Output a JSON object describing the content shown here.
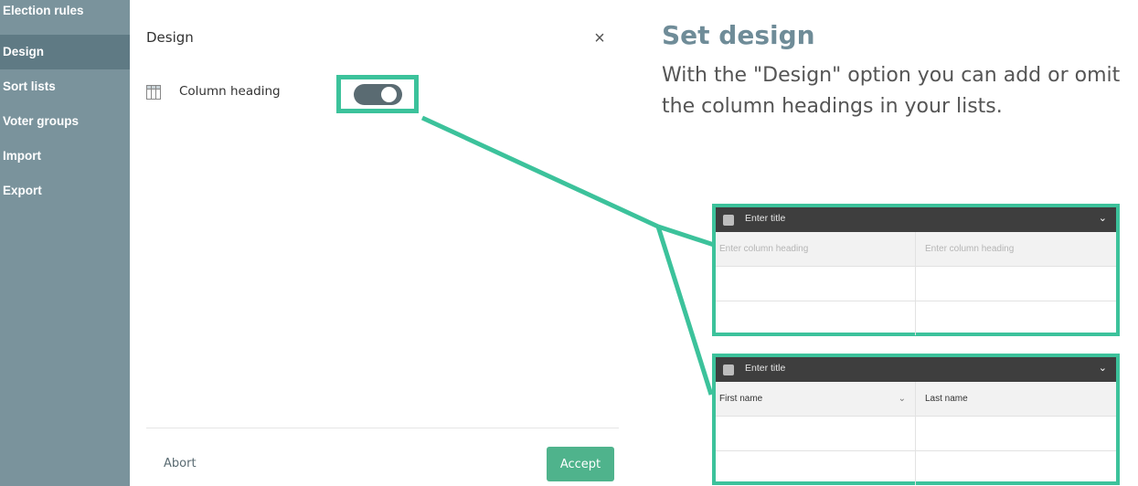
{
  "sidebar": {
    "items": [
      {
        "label": "Election rules"
      },
      {
        "label": "Design"
      },
      {
        "label": "Sort lists"
      },
      {
        "label": "Voter groups"
      },
      {
        "label": "Import"
      },
      {
        "label": "Export"
      }
    ]
  },
  "dialog": {
    "title": "Design",
    "close": "×",
    "option_label": "Column heading",
    "toggle_on": true,
    "abort_label": "Abort",
    "accept_label": "Accept"
  },
  "explain": {
    "headline": "Set design",
    "description": "With the \"Design\" option you can add or omit the column headings in your lists."
  },
  "preview_without": {
    "title": "Enter title",
    "col1": "Enter column heading",
    "col2": "Enter column heading"
  },
  "preview_with": {
    "title": "Enter title",
    "col1": "First name",
    "col2": "Last name"
  },
  "colors": {
    "accent": "#3cc29b",
    "sidebar": "#7a939c",
    "sidebar_active": "#5f7a84",
    "accept_button": "#4fb38c"
  }
}
